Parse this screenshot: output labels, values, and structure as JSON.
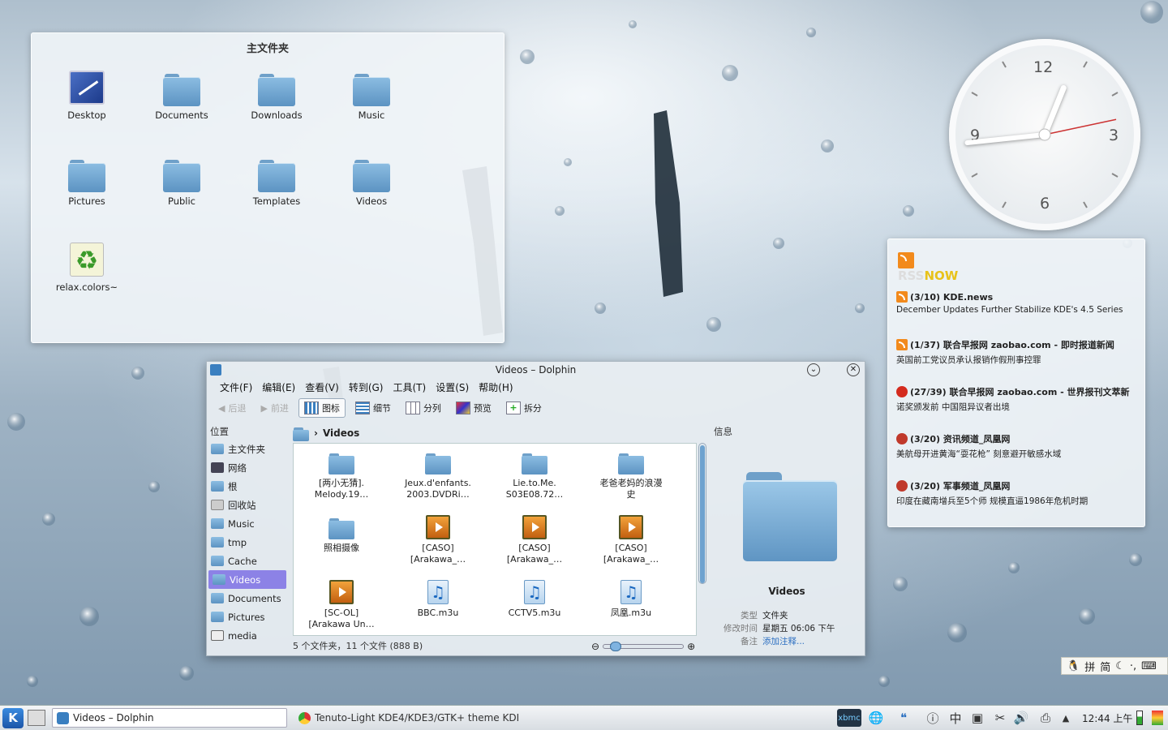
{
  "folderview": {
    "title": "主文件夹",
    "items": [
      {
        "label": "Desktop",
        "icon": "desktop-icon"
      },
      {
        "label": "Documents",
        "icon": "folder-icon"
      },
      {
        "label": "Downloads",
        "icon": "folder-icon"
      },
      {
        "label": "Music",
        "icon": "folder-icon"
      },
      {
        "label": "Pictures",
        "icon": "folder-icon"
      },
      {
        "label": "Public",
        "icon": "folder-icon"
      },
      {
        "label": "Templates",
        "icon": "folder-icon"
      },
      {
        "label": "Videos",
        "icon": "folder-icon"
      },
      {
        "label": "relax.colors~",
        "icon": "recycle-file-icon"
      }
    ]
  },
  "clock": {
    "n12": "12",
    "n3": "3",
    "n6": "6",
    "n9": "9",
    "time_hour": 12,
    "time_minute": 44,
    "time_second": 13
  },
  "rss": {
    "logo_rss": "RSS",
    "logo_now": "NOW",
    "items": [
      {
        "head": "(3/10) KDE.news",
        "sub": "December Updates Further Stabilize KDE's 4.5 Series",
        "icon": "rss-feed-icon"
      },
      {
        "head": "(1/37) 联合早报网 zaobao.com - 即时报道新闻",
        "sub": "英国前工党议员承认报销作假刑事控罪",
        "icon": "rss-feed-icon"
      },
      {
        "head": "(27/39) 联合早报网 zaobao.com - 世界报刊文萃新",
        "sub": "诺奖颁发前 中国阻异议者出境",
        "icon": "news-red-icon"
      },
      {
        "head": "(3/20) 资讯频道_凤凰网",
        "sub": "美航母开进黄海“耍花枪” 刻意避开敏感水域",
        "icon": "ifeng-icon"
      },
      {
        "head": "(3/20) 军事频道_凤凰网",
        "sub": "印度在藏南增兵至5个师 规模直逼1986年危机时期",
        "icon": "ifeng-icon"
      }
    ]
  },
  "dolphin": {
    "title": "Videos – Dolphin",
    "menu": [
      "文件(F)",
      "编辑(E)",
      "查看(V)",
      "转到(G)",
      "工具(T)",
      "设置(S)",
      "帮助(H)"
    ],
    "toolbar": {
      "back": "后退",
      "forward": "前进",
      "icons": "图标",
      "details": "细节",
      "columns": "分列",
      "preview": "预览",
      "split": "拆分"
    },
    "places_header": "位置",
    "places": [
      "主文件夹",
      "网络",
      "根",
      "回收站",
      "Music",
      "tmp",
      "Cache",
      "Videos",
      "Documents",
      "Pictures",
      "media"
    ],
    "selected_place": "Videos",
    "breadcrumb": "Videos",
    "files": [
      {
        "l1": "[两小无猜].",
        "l2": "Melody.19…",
        "type": "folder"
      },
      {
        "l1": "Jeux.d'enfants.",
        "l2": "2003.DVDRi…",
        "type": "folder"
      },
      {
        "l1": "Lie.to.Me.",
        "l2": "S03E08.72…",
        "type": "folder"
      },
      {
        "l1": "老爸老妈的浪漫",
        "l2": "史",
        "type": "folder"
      },
      {
        "l1": "照相摄像",
        "l2": "",
        "type": "folder"
      },
      {
        "l1": "[CASO]",
        "l2": "[Arakawa_…",
        "type": "video"
      },
      {
        "l1": "[CASO]",
        "l2": "[Arakawa_…",
        "type": "video"
      },
      {
        "l1": "[CASO]",
        "l2": "[Arakawa_…",
        "type": "video"
      },
      {
        "l1": "[SC-OL]",
        "l2": "[Arakawa Un…",
        "type": "video"
      },
      {
        "l1": "BBC.m3u",
        "l2": "",
        "type": "music"
      },
      {
        "l1": "CCTV5.m3u",
        "l2": "",
        "type": "music"
      },
      {
        "l1": "凤凰.m3u",
        "l2": "",
        "type": "music"
      }
    ],
    "status": "5 个文件夹，11 个文件 (888 B)",
    "info": {
      "header": "信息",
      "name": "Videos",
      "type_k": "类型",
      "type_v": "文件夹",
      "mod_k": "修改时间",
      "mod_v": "星期五 06:06 下午",
      "note_k": "备注",
      "note_v": "添加注释..."
    }
  },
  "ime": {
    "pin": "拼",
    "jian": "简"
  },
  "taskbar": {
    "tasks": [
      {
        "label": "Videos – Dolphin",
        "active": true
      },
      {
        "label": "Tenuto-Light KDE4/KDE3/GTK+ theme KDE-Look",
        "active": false
      }
    ],
    "xbmc": "xbmc",
    "zh": "中",
    "clock": "12:44 上午"
  },
  "colors": {
    "accent": "#8c82e6",
    "folder": "#6fa0c9",
    "rss": "#f28a1c"
  }
}
